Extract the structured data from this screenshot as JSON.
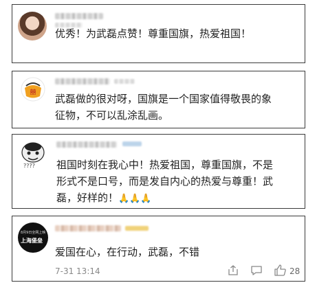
{
  "comments": [
    {
      "author": "",
      "text": "优秀！为武磊点赞！尊重国旗，热爱祖国！"
    },
    {
      "author": "",
      "text_line1": "武磊做的很对呀，国旗是一个国家值得敬畏的象",
      "text_line2": "征物，不可以乱涂乱画。",
      "badge": "wedding"
    },
    {
      "author": "",
      "avatar_caption": "????",
      "text_line1": "祖国时刻在我心中！热爱祖国，尊重国旗，不是",
      "text_line2": "形式不是口号，而是发自内心的热爱与尊重！武",
      "text_line3": "磊，好样的！",
      "emojis": "🙏🙏🙏"
    },
    {
      "author": "",
      "avatar_line1": "8月9日全网上映",
      "avatar_line2": "上海堡垒",
      "text": "爱国在心，在行动，武磊，不错",
      "time": "7-31 13:14",
      "likes": "28"
    }
  ],
  "colors": {
    "border": "#3a3a3a",
    "text": "#222222",
    "meta": "#888888"
  }
}
